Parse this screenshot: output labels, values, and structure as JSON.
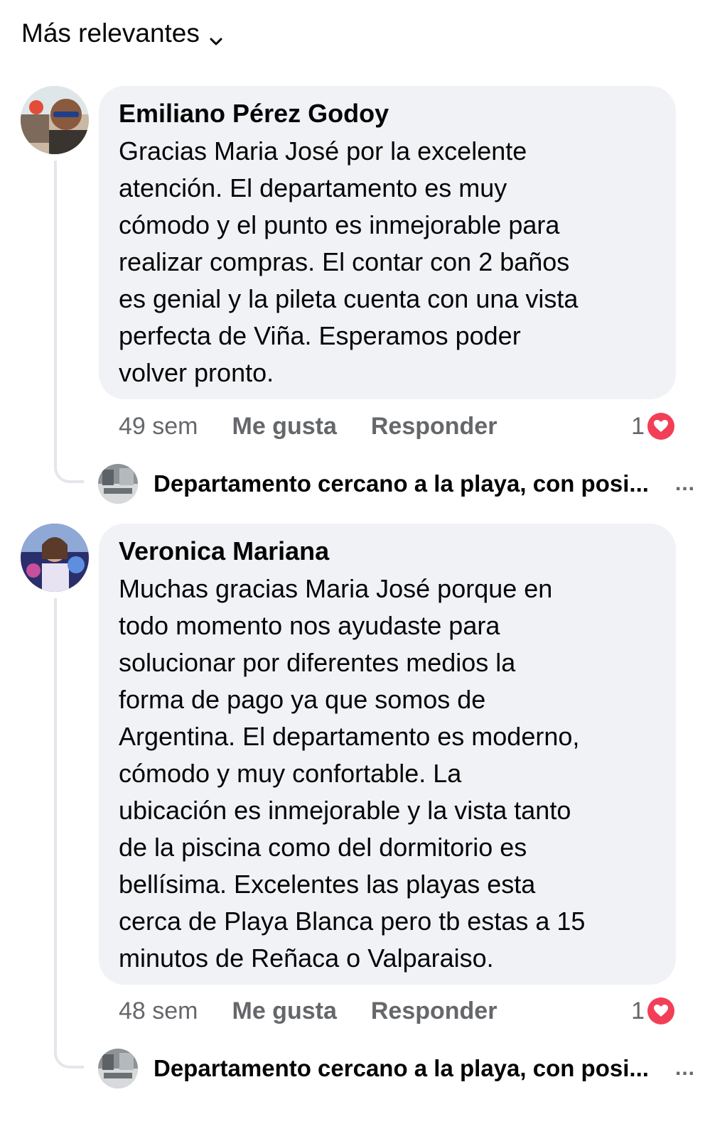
{
  "sort": {
    "label": "Más relevantes"
  },
  "comments": [
    {
      "author": "Emiliano Pérez Godoy",
      "lines": [
        "Gracias Maria José por la excelente",
        "atención. El departamento es muy",
        "cómodo y el punto es inmejorable para",
        "realizar compras. El contar con 2 baños",
        "es genial y la pileta cuenta con una vista",
        "perfecta de Viña. Esperamos poder",
        "volver pronto."
      ],
      "time": "49 sem",
      "like_label": "Me gusta",
      "reply_label": "Responder",
      "reaction_count": "1",
      "reply_preview": "Departamento cercano a la playa, con posi...",
      "more_label": "..."
    },
    {
      "author": "Veronica Mariana",
      "lines": [
        "Muchas gracias Maria José porque en",
        "todo momento nos ayudaste para",
        "solucionar por diferentes medios la",
        "forma de pago ya que somos de",
        "Argentina.  El departamento es moderno,",
        "cómodo y muy confortable.  La",
        "ubicación es inmejorable y la vista tanto",
        "de la piscina como del dormitorio es",
        "bellísima. Excelentes las playas esta",
        "cerca de Playa Blanca pero tb estas a 15",
        "minutos de Reñaca o Valparaiso."
      ],
      "time": "48 sem",
      "like_label": "Me gusta",
      "reply_label": "Responder",
      "reaction_count": "1",
      "reply_preview": "Departamento cercano a la playa, con posi...",
      "more_label": "..."
    }
  ],
  "colors": {
    "bubble": "#f0f2f5",
    "secondary_text": "#65676b",
    "love_reaction": "#f33e58"
  },
  "icons": {
    "sort": "chevron-down-icon",
    "reaction": "heart-icon"
  }
}
